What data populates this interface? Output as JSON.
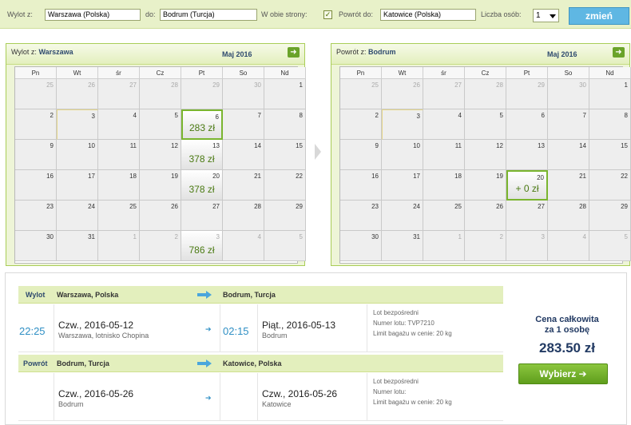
{
  "search": {
    "from_label": "Wylot z:",
    "from_value": "Warszawa (Polska)",
    "to_label": "do:",
    "to_value": "Bodrum (Turcja)",
    "roundtrip_label": "W obie strony:",
    "roundtrip_check": "✓",
    "return_label": "Powrót do:",
    "return_value": "Katowice (Polska)",
    "persons_label": "Liczba osób:",
    "persons_value": "1",
    "submit_label": "zmień"
  },
  "dow": [
    "Pn",
    "Wt",
    "śr",
    "Cz",
    "Pt",
    "So",
    "Nd"
  ],
  "outbound_cal": {
    "title_prefix": "Wylot z:",
    "title_city": "Warszawa",
    "month": "Maj 2016",
    "next": "➜",
    "days": [
      "25",
      "26",
      "27",
      "28",
      "29",
      "30",
      "1",
      "2",
      "3",
      "4",
      "5",
      "6",
      "7",
      "8",
      "9",
      "10",
      "11",
      "12",
      "13",
      "14",
      "15",
      "16",
      "17",
      "18",
      "19",
      "20",
      "21",
      "22",
      "23",
      "24",
      "25",
      "26",
      "27",
      "28",
      "29",
      "30",
      "31",
      "1",
      "2",
      "3",
      "4",
      "5"
    ],
    "muted": [
      0,
      1,
      2,
      3,
      4,
      5,
      37,
      38,
      39,
      40,
      41
    ],
    "prices": {
      "11": "283 zł",
      "18": "378 zł",
      "25": "378 zł",
      "39": "786 zł"
    },
    "selected": 11,
    "today": 8
  },
  "return_cal": {
    "title_prefix": "Powrót z:",
    "title_city": "Bodrum",
    "month": "Maj 2016",
    "next": "➜",
    "days": [
      "25",
      "26",
      "27",
      "28",
      "29",
      "30",
      "1",
      "2",
      "3",
      "4",
      "5",
      "6",
      "7",
      "8",
      "9",
      "10",
      "11",
      "12",
      "13",
      "14",
      "15",
      "16",
      "17",
      "18",
      "19",
      "20",
      "21",
      "22",
      "23",
      "24",
      "25",
      "26",
      "27",
      "28",
      "29",
      "30",
      "31",
      "1",
      "2",
      "3",
      "4",
      "5"
    ],
    "muted": [
      0,
      1,
      2,
      3,
      4,
      5,
      37,
      38,
      39,
      40,
      41
    ],
    "prices": {
      "25": "+ 0 zł"
    },
    "selected": 25,
    "today": 8
  },
  "outbound": {
    "label": "Wylot",
    "from": "Warszawa, Polska",
    "to": "Bodrum, Turcja",
    "dep_time": "22:25",
    "dep_date": "Czw., 2016-05-12",
    "dep_place": "Warszawa, lotnisko Chopina",
    "arr_time": "02:15",
    "arr_date": "Piąt., 2016-05-13",
    "arr_place": "Bodrum",
    "info1": "Lot bezpośredni",
    "info2": "Numer lotu: TVP7210",
    "info3": "Limit bagażu w cenie: 20 kg"
  },
  "return": {
    "label": "Powrót",
    "from": "Bodrum, Turcja",
    "to": "Katowice, Polska",
    "dep_date": "Czw., 2016-05-26",
    "dep_place": "Bodrum",
    "arr_date": "Czw., 2016-05-26",
    "arr_place": "Katowice",
    "info1": "Lot bezpośredni",
    "info2": "Numer lotu:",
    "info3": "Limit bagażu w cenie: 20 kg"
  },
  "summary": {
    "total_line1": "Cena całkowita",
    "total_line2": "za 1 osobę",
    "amount": "283.50 zł",
    "choose": "Wybierz ➔"
  },
  "colors": {
    "accent": "#7ab52f",
    "link": "#2f8fc4",
    "button": "#5fb7e3"
  }
}
